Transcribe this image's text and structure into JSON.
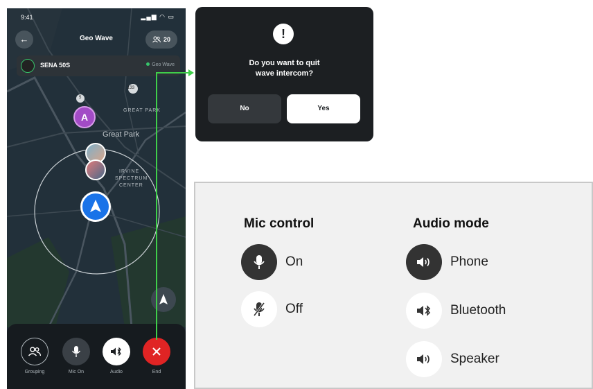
{
  "phone": {
    "status_time": "9:41",
    "header": {
      "back_icon": "arrow-left-icon",
      "title": "Geo Wave",
      "members_icon": "group-icon",
      "members_count": "20"
    },
    "device": {
      "name": "SENA 50S",
      "status": "Geo Wave",
      "status_color": "#37c46b"
    },
    "map": {
      "labels": [
        "GREAT PARK",
        "Great Park",
        "IRVINE",
        "SPECTRUM",
        "CENTER"
      ],
      "route_shield_1": "133",
      "route_shield_2": "5",
      "user_pin_label": "A",
      "user_pin_color": "#a24bc6",
      "self_color": "#1a73e8"
    },
    "controls": [
      {
        "label": "Grouping",
        "icon": "group-icon"
      },
      {
        "label": "Mic On",
        "icon": "microphone-icon"
      },
      {
        "label": "Audio",
        "icon": "bluetooth-speaker-icon"
      },
      {
        "label": "End",
        "icon": "close-icon",
        "color": "#e02424"
      }
    ]
  },
  "dialog": {
    "icon": "exclamation-icon",
    "message_line1": "Do you want to quit",
    "message_line2": "wave intercom?",
    "no_label": "No",
    "yes_label": "Yes"
  },
  "connector_color": "#3fcf4a",
  "panel": {
    "mic_title": "Mic control",
    "mic_options": [
      {
        "label": "On",
        "icon": "microphone-icon",
        "active": true
      },
      {
        "label": "Off",
        "icon": "microphone-muted-icon",
        "active": false
      }
    ],
    "audio_title": "Audio mode",
    "audio_options": [
      {
        "label": "Phone",
        "icon": "speaker-icon",
        "active": true
      },
      {
        "label": "Bluetooth",
        "icon": "bluetooth-speaker-icon",
        "active": false
      },
      {
        "label": "Speaker",
        "icon": "speaker-icon",
        "active": false
      }
    ]
  }
}
